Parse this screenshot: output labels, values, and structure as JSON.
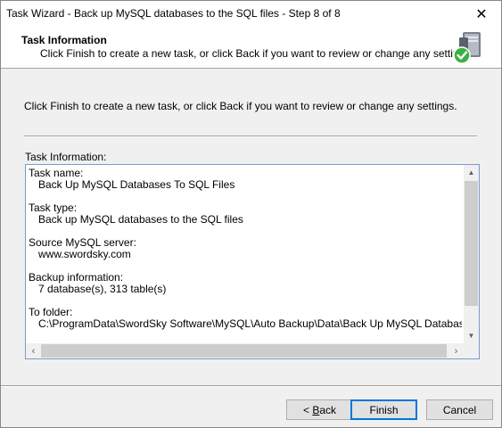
{
  "window": {
    "title": "Task Wizard - Back up MySQL databases to the SQL files - Step 8 of 8",
    "close_glyph": "✕"
  },
  "header": {
    "title": "Task Information",
    "subtitle": "Click Finish to create a new task, or click Back if you want to review or change any settings.",
    "icon": "server-check-icon"
  },
  "main": {
    "intro": "Click Finish to create a new task, or click Back if you want to review or change any settings.",
    "info_label": "Task Information:",
    "info": [
      {
        "label": "Task name:",
        "value": "Back Up MySQL Databases To SQL Files"
      },
      {
        "label": "Task type:",
        "value": "Back up MySQL databases to the SQL files"
      },
      {
        "label": "Source MySQL server:",
        "value": "www.swordsky.com"
      },
      {
        "label": "Backup information:",
        "value": "7 database(s), 313 table(s)"
      },
      {
        "label": "To folder:",
        "value": "C:\\ProgramData\\SwordSky Software\\MySQL\\Auto Backup\\Data\\Back Up MySQL Databases To SQL Files"
      }
    ]
  },
  "buttons": {
    "back_prefix": "< ",
    "back_mnemonic": "B",
    "back_rest": "ack",
    "finish": "Finish",
    "cancel": "Cancel"
  },
  "colors": {
    "accent": "#0078d7",
    "check_green": "#3cb043"
  }
}
